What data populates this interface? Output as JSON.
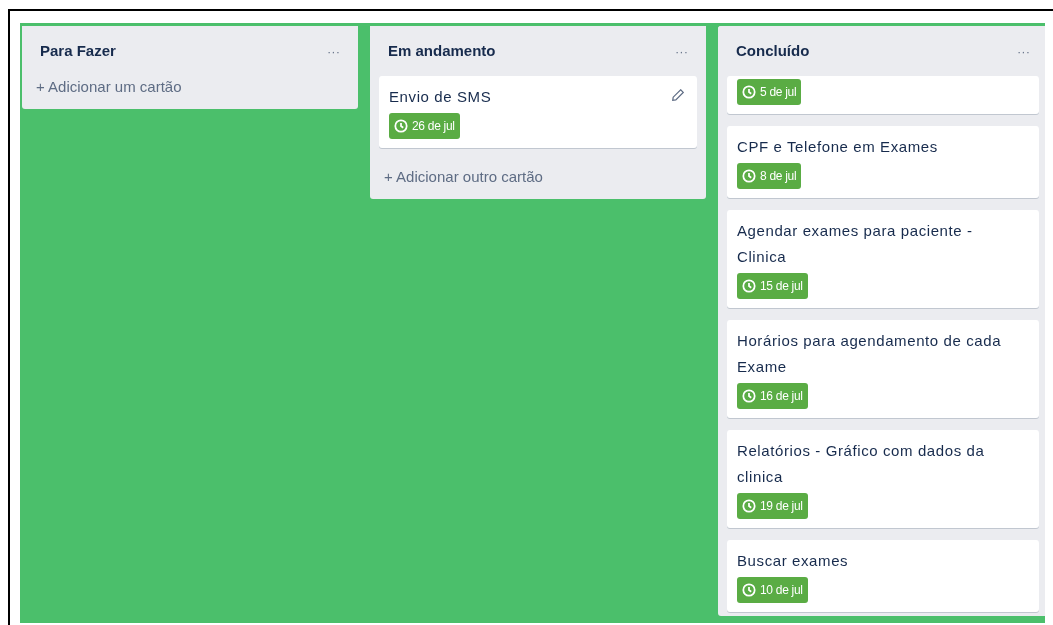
{
  "lists": [
    {
      "title": "Para Fazer",
      "menu": "···",
      "add_label": "+ Adicionar um cartão"
    },
    {
      "title": "Em andamento",
      "menu": "···",
      "cards": [
        {
          "title": "Envio de SMS",
          "due": "26 de jul",
          "editable": true
        }
      ],
      "add_label": "+ Adicionar outro cartão"
    },
    {
      "title": "Concluído",
      "menu": "···",
      "cards": [
        {
          "due": "5 de jul",
          "editable": false
        },
        {
          "title": "CPF e Telefone em Exames",
          "due": "8 de jul",
          "editable": false
        },
        {
          "title": "Agendar exames para paciente - Clinica",
          "due": "15 de jul",
          "editable": false
        },
        {
          "title": "Horários para agendamento de cada Exame",
          "due": "16 de jul",
          "editable": false
        },
        {
          "title": "Relatórios - Gráfico com dados da clinica",
          "due": "19 de jul",
          "editable": false
        },
        {
          "title": "Buscar exames",
          "due": "10 de jul",
          "editable": false
        }
      ]
    }
  ]
}
